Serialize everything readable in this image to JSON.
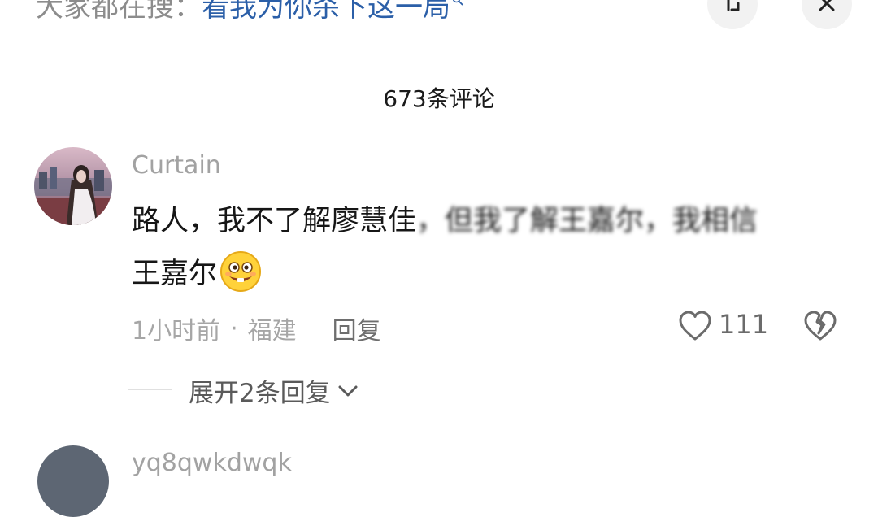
{
  "search_hint": {
    "prefix": "大家都在搜：",
    "term": "看我为你杀下这一局",
    "icon": "search-icon"
  },
  "header_buttons": {
    "collapse_icon": "collapse-icon",
    "close_icon": "close-icon"
  },
  "comments_count": "673条评论",
  "comment": {
    "username": "Curtain",
    "text_line1_a": "路人，我不了解廖慧佳",
    "text_line1_b": "，但我了解王嘉尔，我相信",
    "text_line2": "王嘉尔",
    "emoji": "grinning-emoji",
    "time": "1小时前",
    "dot": "·",
    "location": "福建",
    "reply_label": "回复",
    "like_count": "111",
    "expand_label": "展开2条回复"
  },
  "next_comment": {
    "username": "yq8qwkdwqk"
  },
  "colors": {
    "search_term": "#2b5fa8",
    "muted_text": "#a6a6a6",
    "button_bg": "#f2f2f2"
  }
}
